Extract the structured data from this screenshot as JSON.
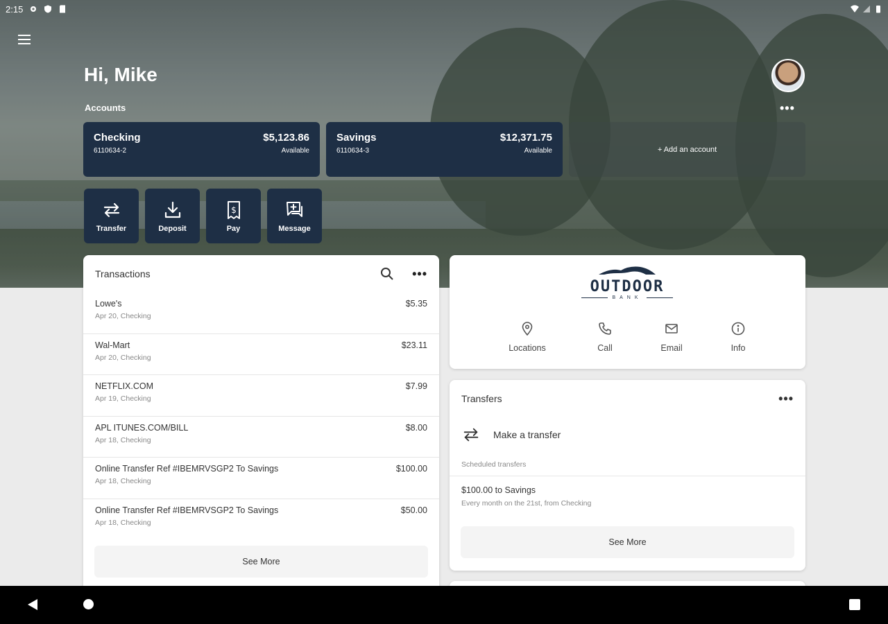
{
  "status_bar": {
    "time": "2:15"
  },
  "header": {
    "greeting": "Hi, Mike",
    "accounts_label": "Accounts",
    "more": "•••"
  },
  "accounts": [
    {
      "name": "Checking",
      "number": "6110634-2",
      "balance": "$5,123.86",
      "balance_label": "Available"
    },
    {
      "name": "Savings",
      "number": "6110634-3",
      "balance": "$12,371.75",
      "balance_label": "Available"
    }
  ],
  "add_account": "+ Add an account",
  "actions": [
    {
      "label": "Transfer",
      "icon": "transfer-icon"
    },
    {
      "label": "Deposit",
      "icon": "deposit-icon"
    },
    {
      "label": "Pay",
      "icon": "pay-icon"
    },
    {
      "label": "Message",
      "icon": "message-icon"
    }
  ],
  "transactions": {
    "title": "Transactions",
    "more": "•••",
    "items": [
      {
        "name": "Lowe's",
        "sub": "Apr 20, Checking",
        "amount": "$5.35"
      },
      {
        "name": "Wal-Mart",
        "sub": "Apr 20, Checking",
        "amount": "$23.11"
      },
      {
        "name": "NETFLIX.COM",
        "sub": "Apr 19, Checking",
        "amount": "$7.99"
      },
      {
        "name": "APL ITUNES.COM/BILL",
        "sub": "Apr 18, Checking",
        "amount": "$8.00"
      },
      {
        "name": "Online Transfer Ref #IBEMRVSGP2 To Savings",
        "sub": "Apr 18, Checking",
        "amount": "$100.00"
      },
      {
        "name": "Online Transfer Ref #IBEMRVSGP2 To Savings",
        "sub": "Apr 18, Checking",
        "amount": "$50.00"
      }
    ],
    "see_more": "See More"
  },
  "bank": {
    "logo_word": "OUTDOOR",
    "logo_sub": "BANK",
    "links": [
      {
        "label": "Locations",
        "icon": "location-pin-icon"
      },
      {
        "label": "Call",
        "icon": "phone-icon"
      },
      {
        "label": "Email",
        "icon": "envelope-icon"
      },
      {
        "label": "Info",
        "icon": "info-icon"
      }
    ]
  },
  "transfers": {
    "title": "Transfers",
    "more": "•••",
    "make_transfer": "Make a transfer",
    "scheduled_label": "Scheduled transfers",
    "scheduled": [
      {
        "title": "$100.00 to Savings",
        "sub": "Every month on the 21st, from Checking"
      }
    ],
    "see_more": "See More"
  }
}
